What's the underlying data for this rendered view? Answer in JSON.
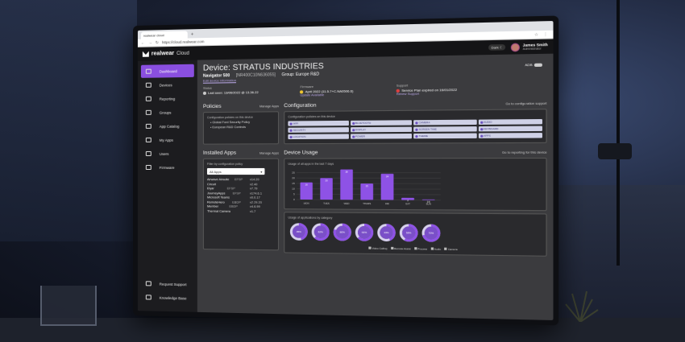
{
  "browser": {
    "tab_title": "realwear cloud",
    "url": "https://cloud.realwear.com"
  },
  "header": {
    "logo_text": "realwear",
    "logo_suffix": "Cloud",
    "dark_toggle": "Dark",
    "user_name": "James Smith",
    "user_role": "Administrator"
  },
  "sidebar": {
    "items": [
      {
        "label": "Dashboard",
        "icon": "dashboard-icon"
      },
      {
        "label": "Devices",
        "icon": "devices-icon"
      },
      {
        "label": "Reporting",
        "icon": "reporting-icon"
      },
      {
        "label": "Groups",
        "icon": "groups-icon"
      },
      {
        "label": "App Catalog",
        "icon": "app-catalog-icon"
      },
      {
        "label": "My Apps",
        "icon": "my-apps-icon"
      },
      {
        "label": "Users",
        "icon": "users-icon"
      },
      {
        "label": "Firmware",
        "icon": "firmware-icon"
      }
    ],
    "bottom": [
      {
        "label": "Request Support",
        "icon": "support-icon"
      },
      {
        "label": "Knowledge Base",
        "icon": "knowledge-icon"
      }
    ]
  },
  "device": {
    "title_prefix": "Device:",
    "title_name": "STRATUS INDUSTRIES",
    "model": "Navigator 500",
    "serial": "[NR400C10N636055]",
    "group": "Group: Europe R&D",
    "edit_link": "Edit device information",
    "adb_label": "ADB"
  },
  "status": {
    "status_label": "Status",
    "status_value": "Last seen: 13/06/2022 @ 13.36.22",
    "firmware_label": "Firmware",
    "firmware_value": "April 2022 (11.5.7+C.NA0506.6)",
    "firmware_link": "Update Available",
    "support_label": "Support",
    "support_value": "Service Plan expired on 16/01/2022",
    "support_link": "Renew Support"
  },
  "policies": {
    "title": "Policies",
    "link": "Manage Apps",
    "card_label": "Configuration policies on this device",
    "items": [
      "Global Ford Security Policy",
      "European R&D Controls"
    ]
  },
  "configuration": {
    "title": "Configuration",
    "link": "Go to configuration support",
    "card_label": "Configuration policies on this device",
    "chips": [
      "WIFI",
      "BLUETOOTH",
      "CAMERA",
      "AUDIO",
      "SECURITY",
      "DISPLAY",
      "SCREEN TIME",
      "KEYBOARD",
      "LOCATION",
      "POWER",
      "THEME",
      "APPS"
    ]
  },
  "installed_apps": {
    "title": "Installed Apps",
    "link": "Manage Apps",
    "filter_label": "Filter by configuration policy",
    "select_value": "All Apps",
    "apps": [
      {
        "name": "Airwave Airsuite",
        "src": "EFSP",
        "ver": "v14.20"
      },
      {
        "name": "Circuit",
        "src": "",
        "ver": "v2.40"
      },
      {
        "name": "Elyar",
        "src": "EFSP",
        "ver": "v7.79"
      },
      {
        "name": "JourneyApps",
        "src": "EFSP",
        "ver": "v174.6.1"
      },
      {
        "name": "Microsoft Teams",
        "src": "",
        "ver": "v0.0.17"
      },
      {
        "name": "RemoteHero",
        "src": "EBDP",
        "ver": "v2.29.20"
      },
      {
        "name": "Member",
        "src": "EBDP",
        "ver": "v4.6.99"
      },
      {
        "name": "Thermal Camera",
        "src": "",
        "ver": "v1.7"
      }
    ]
  },
  "device_usage": {
    "title": "Device Usage",
    "link": "Go to reporting for this device",
    "bar_label": "Usage of all apps in the last 7 days",
    "donut_label": "Usage of applications by category",
    "legend": [
      "Video Calling",
      "Remote Assist",
      "Process",
      "Audio",
      "Camera"
    ]
  },
  "chart_data": [
    {
      "type": "bar",
      "title": "Usage of all apps in the last 7 days",
      "categories": [
        "MON",
        "TUES",
        "WED",
        "THURS",
        "FRI",
        "SAT",
        "SUN"
      ],
      "values": [
        16,
        20,
        28,
        15,
        24,
        2,
        0.6
      ],
      "ylim": [
        0,
        30
      ],
      "yticks": [
        0,
        5,
        10,
        15,
        20,
        25
      ],
      "bar_color": "#8e52e6"
    },
    {
      "type": "pie",
      "title": "Usage of applications by category",
      "values": [
        45,
        62,
        80,
        63,
        43,
        58,
        70
      ],
      "labels": [
        "45%",
        "62%",
        "80%",
        "63%",
        "43%",
        "58%",
        "70%"
      ],
      "color": "#8e52e6"
    }
  ]
}
